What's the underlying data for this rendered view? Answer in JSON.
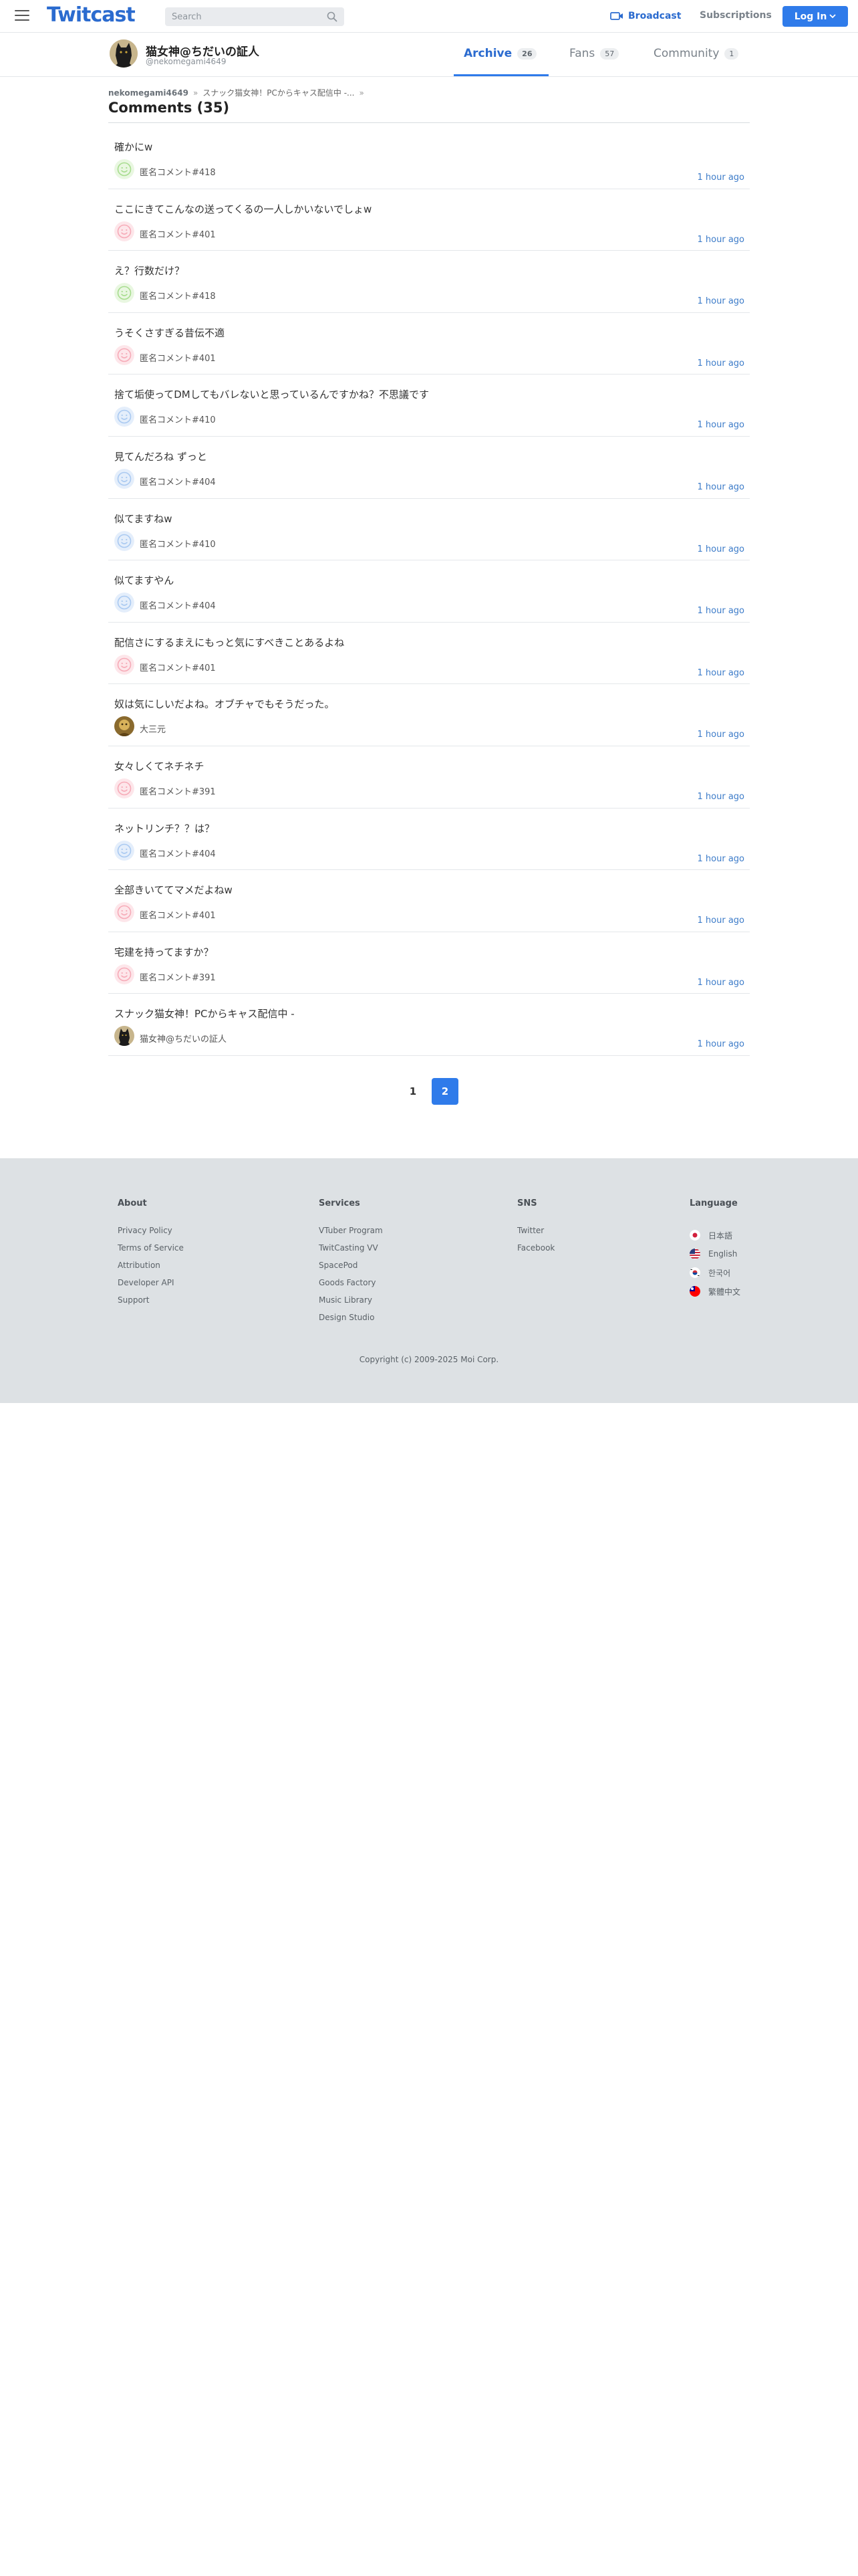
{
  "header": {
    "logo": "Twitcast",
    "search_placeholder": "Search",
    "broadcast_label": "Broadcast",
    "subscriptions_label": "Subscriptions",
    "login_label": "Log In",
    "accent_color": "#2f7bea"
  },
  "profile": {
    "name": "猫女神@ちだいの証人",
    "handle": "@nekomegami4649",
    "tabs": [
      {
        "label": "Archive",
        "count": "26",
        "active": true
      },
      {
        "label": "Fans",
        "count": "57",
        "active": false
      },
      {
        "label": "Community",
        "count": "1",
        "active": false
      }
    ]
  },
  "breadcrumb": {
    "root": "nekomegami4649",
    "stream": "スナック猫女神！PCからキャス配信中 -..."
  },
  "page_title": "Comments (35)",
  "comments": [
    {
      "text": "確かにw",
      "author": "匿名コメント#418",
      "time": "1 hour ago",
      "avatar": "smile-green"
    },
    {
      "text": "ここにきてこんなの送ってくるの一人しかいないでしょw",
      "author": "匿名コメント#401",
      "time": "1 hour ago",
      "avatar": "smile-pink"
    },
    {
      "text": "え？行数だけ？",
      "author": "匿名コメント#418",
      "time": "1 hour ago",
      "avatar": "smile-green"
    },
    {
      "text": "うそくさすぎる昔伝不適",
      "author": "匿名コメント#401",
      "time": "1 hour ago",
      "avatar": "smile-pink"
    },
    {
      "text": "捨て垢使ってDMしてもバレないと思っているんですかね？不思議です",
      "author": "匿名コメント#410",
      "time": "1 hour ago",
      "avatar": "smile-blue"
    },
    {
      "text": "見てんだろね ずっと",
      "author": "匿名コメント#404",
      "time": "1 hour ago",
      "avatar": "smile-blue"
    },
    {
      "text": "似てますねw",
      "author": "匿名コメント#410",
      "time": "1 hour ago",
      "avatar": "smile-blue"
    },
    {
      "text": "似てますやん",
      "author": "匿名コメント#404",
      "time": "1 hour ago",
      "avatar": "smile-blue"
    },
    {
      "text": "配信さにするまえにもっと気にすべきことあるよね",
      "author": "匿名コメント#401",
      "time": "1 hour ago",
      "avatar": "smile-pink"
    },
    {
      "text": "奴は気にしいだよね。オブチャでもそうだった。",
      "author": "大三元",
      "time": "1 hour ago",
      "avatar": "photo-gold"
    },
    {
      "text": "女々しくてネチネチ",
      "author": "匿名コメント#391",
      "time": "1 hour ago",
      "avatar": "smile-pink"
    },
    {
      "text": "ネットリンチ？？は？",
      "author": "匿名コメント#404",
      "time": "1 hour ago",
      "avatar": "smile-blue"
    },
    {
      "text": "全部きいててマメだよねw",
      "author": "匿名コメント#401",
      "time": "1 hour ago",
      "avatar": "smile-pink"
    },
    {
      "text": "宅建を持ってますか？",
      "author": "匿名コメント#391",
      "time": "1 hour ago",
      "avatar": "smile-pink"
    },
    {
      "text": "スナック猫女神！PCからキャス配信中 -",
      "author": "猫女神@ちだいの証人",
      "time": "1 hour ago",
      "avatar": "photo-cat"
    }
  ],
  "pagination": {
    "pages": [
      "1",
      "2"
    ],
    "current": "2"
  },
  "footer": {
    "about": {
      "heading": "About",
      "links": [
        "Privacy Policy",
        "Terms of Service",
        "Attribution",
        "Developer API",
        "Support"
      ]
    },
    "services": {
      "heading": "Services",
      "links": [
        "VTuber Program",
        "TwitCasting VV",
        "SpacePod",
        "Goods Factory",
        "Music Library",
        "Design Studio"
      ]
    },
    "sns": {
      "heading": "SNS",
      "links": [
        "Twitter",
        "Facebook"
      ]
    },
    "language": {
      "heading": "Language",
      "items": [
        {
          "label": "日本語",
          "flag": "flag-japan-icon"
        },
        {
          "label": "English",
          "flag": "flag-usa-icon"
        },
        {
          "label": "한국어",
          "flag": "flag-korea-icon"
        },
        {
          "label": "繁體中文",
          "flag": "flag-taiwan-icon"
        }
      ]
    },
    "copyright": "Copyright (c) 2009-2025 Moi Corp."
  },
  "icons": {
    "menu": "hamburger-menu-icon",
    "search": "search-icon",
    "broadcast": "broadcast-camera-icon",
    "login_caret": "chevron-down-icon"
  },
  "colors": {
    "link_blue": "#3d7cc9",
    "smile_green": "#a7dc8e",
    "smile_pink": "#f6aab7",
    "smile_blue": "#a9c9f1",
    "footer_bg": "#dde1e4"
  }
}
